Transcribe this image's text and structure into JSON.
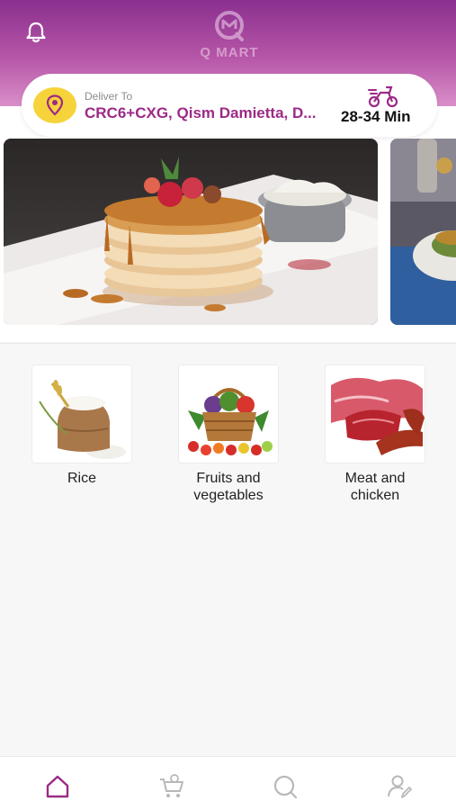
{
  "header": {
    "brand": "Q MART",
    "notification_icon": "bell-icon"
  },
  "delivery": {
    "label": "Deliver To",
    "address": "CRC6+CXG, Qism Damietta, D...",
    "eta": "28-34 Min",
    "pin_icon": "location-pin-icon",
    "eta_icon": "delivery-scooter-icon"
  },
  "banners": [
    {
      "name": "pancakes-banner"
    },
    {
      "name": "food-plate-banner"
    }
  ],
  "categories": [
    {
      "label": "Rice",
      "image": "rice-sack-image"
    },
    {
      "label": "Fruits and vegetables",
      "image": "fruit-basket-image"
    },
    {
      "label": "Meat and chicken",
      "image": "raw-meat-image"
    }
  ],
  "bottom_nav": [
    {
      "icon": "home-icon",
      "active": true
    },
    {
      "icon": "cart-icon",
      "active": false
    },
    {
      "icon": "search-icon",
      "active": false
    },
    {
      "icon": "profile-edit-icon",
      "active": false
    }
  ],
  "colors": {
    "header_gradient_top": "#8a2f8f",
    "header_gradient_bottom": "#d98fc9",
    "accent": "#9c2a86",
    "pin_background": "#f6d33a"
  }
}
